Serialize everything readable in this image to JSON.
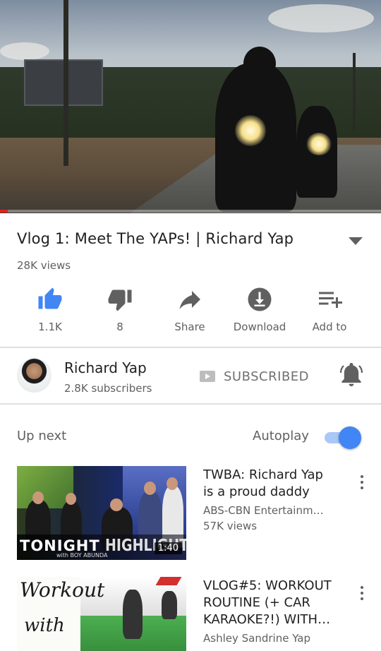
{
  "player": {
    "progress_fraction": 0.02
  },
  "video": {
    "title": "Vlog 1: Meet The YAPs! | Richard Yap",
    "views": "28K views"
  },
  "actions": [
    {
      "icon": "thumbs-up-icon",
      "label": "1.1K",
      "color": "#4285f4"
    },
    {
      "icon": "thumbs-down-icon",
      "label": "8",
      "color": "#606060"
    },
    {
      "icon": "share-icon",
      "label": "Share",
      "color": "#606060"
    },
    {
      "icon": "download-icon",
      "label": "Download",
      "color": "#606060"
    },
    {
      "icon": "playlist-add-icon",
      "label": "Add to",
      "color": "#606060"
    }
  ],
  "channel": {
    "name": "Richard Yap",
    "subscribers": "2.8K subscribers",
    "subscribe_label": "SUBSCRIBED",
    "bell_icon": "notification-bell-icon"
  },
  "upnext": {
    "label": "Up next",
    "autoplay_label": "Autoplay",
    "autoplay_on": true,
    "accent": "#4285f4"
  },
  "videos": [
    {
      "title_line1": "TWBA: Richard Yap",
      "title_line2": "is a proud daddy",
      "channel": "ABS-CBN Entertainm…",
      "views": "57K views",
      "duration": "1:40",
      "thumb_text_1": "TONIGHT",
      "thumb_text_2": "HIGHLIGHTS",
      "thumb_text_3": "with BOY ABUNDA"
    },
    {
      "title_line1": "VLOG#5: WORKOUT",
      "title_line2": "ROUTINE (+ CAR",
      "title_line3": "KARAOKE?!) WITH…",
      "channel": "Ashley Sandrine Yap",
      "thumb_text_1": "Workout",
      "thumb_text_2": "with"
    }
  ]
}
